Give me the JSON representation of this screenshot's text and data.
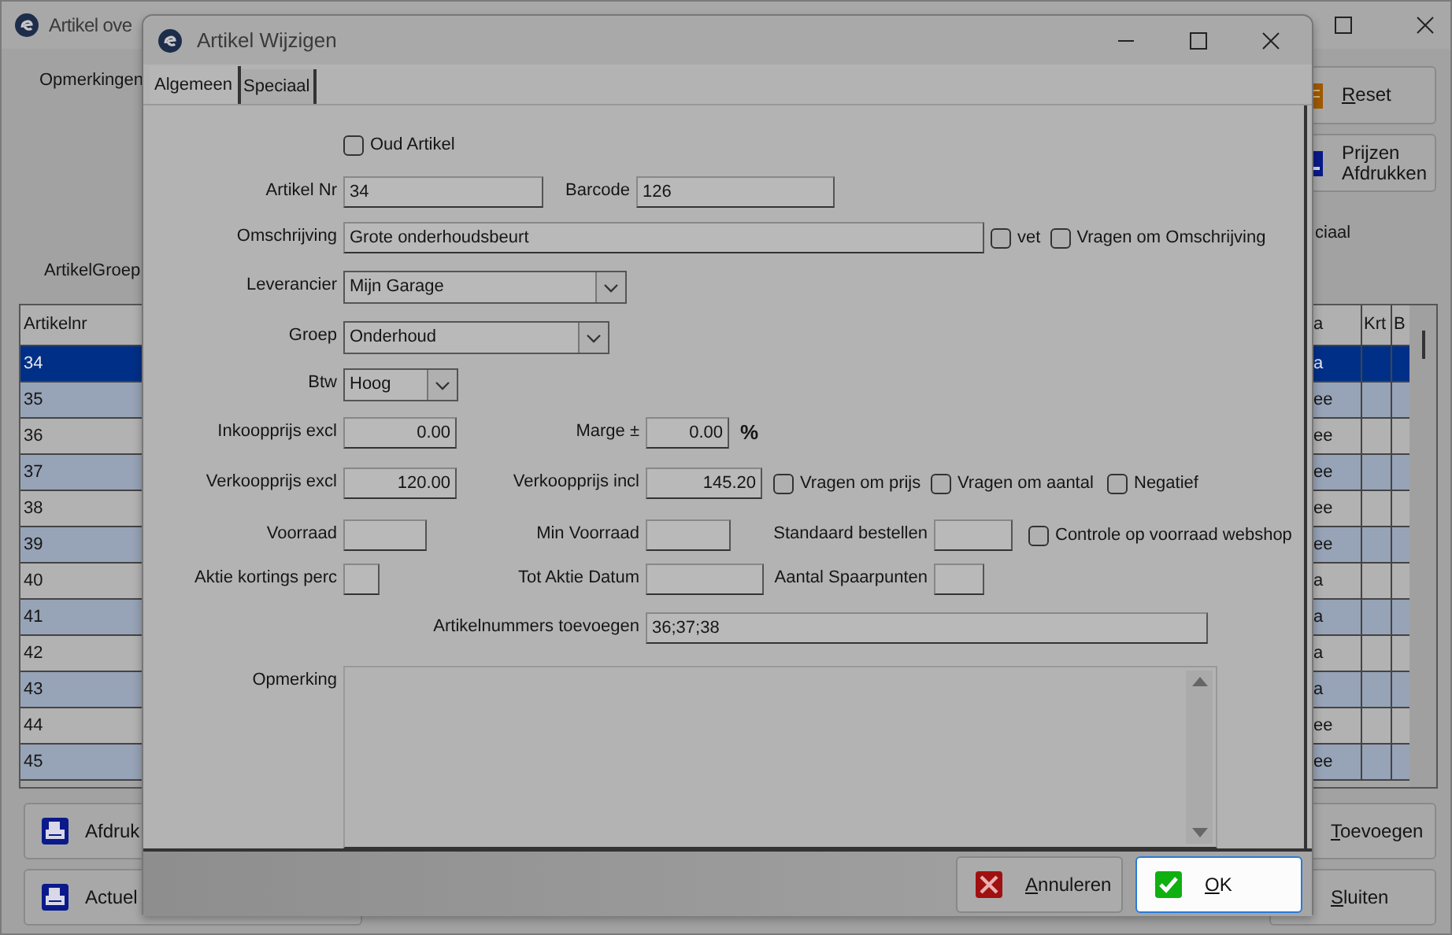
{
  "main_window": {
    "title": "Artikel ove",
    "remarks_label": "Opmerkingen",
    "group_label": "ArtikelGroep",
    "column_label": "ciaal",
    "side_buttons": [
      {
        "label": "Reset",
        "mnemonic": true,
        "kind": "reset"
      },
      {
        "label": "Prijzen Afdrukken",
        "mnemonic": false,
        "kind": "print"
      }
    ],
    "table": {
      "columns": [
        "Artikelnr",
        "a",
        "Krt",
        "B"
      ],
      "rows": [
        {
          "artikelnr": "34",
          "column_2": "a",
          "selected": true
        },
        {
          "artikelnr": "35",
          "column_2": "ee",
          "selected": false
        },
        {
          "artikelnr": "36",
          "column_2": "ee",
          "selected": false
        },
        {
          "artikelnr": "37",
          "column_2": "ee",
          "selected": false
        },
        {
          "artikelnr": "38",
          "column_2": "ee",
          "selected": false
        },
        {
          "artikelnr": "39",
          "column_2": "ee",
          "selected": false
        },
        {
          "artikelnr": "40",
          "column_2": "a",
          "selected": false
        },
        {
          "artikelnr": "41",
          "column_2": "a",
          "selected": false
        },
        {
          "artikelnr": "42",
          "column_2": "a",
          "selected": false
        },
        {
          "artikelnr": "43",
          "column_2": "a",
          "selected": false
        },
        {
          "artikelnr": "44",
          "column_2": "ee",
          "selected": false
        },
        {
          "artikelnr": "45",
          "column_2": "ee",
          "selected": false
        }
      ]
    },
    "left_buttons": [
      {
        "label": "Afdruk"
      },
      {
        "label": "Actuel"
      }
    ],
    "right_buttons": [
      {
        "label": "Toevoegen",
        "mnemonic": true
      },
      {
        "label": "Sluiten",
        "mnemonic": true
      }
    ]
  },
  "dialog": {
    "title": "Artikel Wijzigen",
    "tabs": [
      {
        "label": "Algemeen",
        "selected": true
      },
      {
        "label": "Speciaal",
        "selected": false
      }
    ],
    "rows": [
      {
        "fields": [
          {
            "kind": "checkbox",
            "label": "Oud Artikel",
            "checked": false
          }
        ]
      },
      {
        "fields": [
          {
            "kind": "text",
            "label": "Artikel Nr",
            "value": "34"
          },
          {
            "kind": "text",
            "label": "Barcode",
            "value": "126"
          }
        ]
      },
      {
        "fields": [
          {
            "kind": "text",
            "label": "Omschrijving",
            "value": "Grote onderhoudsbeurt"
          },
          {
            "kind": "checkbox",
            "label": "vet",
            "checked": false
          },
          {
            "kind": "checkbox",
            "label": "Vragen om Omschrijving",
            "checked": false
          }
        ]
      },
      {
        "fields": [
          {
            "kind": "dropdown",
            "label": "Leverancier",
            "value": "Mijn Garage"
          }
        ]
      },
      {
        "fields": [
          {
            "kind": "dropdown",
            "label": "Groep",
            "value": "Onderhoud"
          }
        ]
      },
      {
        "fields": [
          {
            "kind": "dropdown",
            "label": "Btw",
            "value": "Hoog"
          }
        ]
      },
      {
        "fields": [
          {
            "kind": "number",
            "label": "Inkoopprijs excl",
            "value": "0.00"
          },
          {
            "kind": "number",
            "label": "Marge ±",
            "value": "0.00"
          },
          {
            "kind": "unit",
            "text": "%"
          }
        ]
      },
      {
        "fields": [
          {
            "kind": "number",
            "label": "Verkoopprijs excl",
            "value": "120.00"
          },
          {
            "kind": "number",
            "label": "Verkoopprijs incl",
            "value": "145.20"
          },
          {
            "kind": "checkbox",
            "label": "Vragen om prijs",
            "checked": false
          },
          {
            "kind": "checkbox",
            "label": "Vragen om aantal",
            "checked": false
          },
          {
            "kind": "checkbox",
            "label": "Negatief",
            "checked": false
          }
        ]
      },
      {
        "fields": [
          {
            "kind": "text",
            "label": "Voorraad"
          },
          {
            "kind": "text",
            "label": "Min Voorraad"
          },
          {
            "kind": "text",
            "label": "Standaard bestellen"
          },
          {
            "kind": "checkbox",
            "label": "Controle op voorraad webshop",
            "checked": false
          }
        ]
      },
      {
        "fields": [
          {
            "kind": "text",
            "label": "Aktie kortings perc"
          },
          {
            "kind": "text",
            "label": "Tot Aktie Datum"
          },
          {
            "kind": "text",
            "label": "Aantal Spaarpunten"
          }
        ]
      },
      {
        "fields": [
          {
            "kind": "text",
            "label": "Artikelnummers toevoegen",
            "value": "36;37;38"
          }
        ]
      },
      {
        "fields": [
          {
            "kind": "memo",
            "label": "Opmerking"
          }
        ]
      }
    ],
    "buttons": [
      {
        "label": "Annuleren",
        "kind": "cancel",
        "focused": false
      },
      {
        "label": "OK",
        "kind": "ok",
        "focused": true
      }
    ]
  }
}
